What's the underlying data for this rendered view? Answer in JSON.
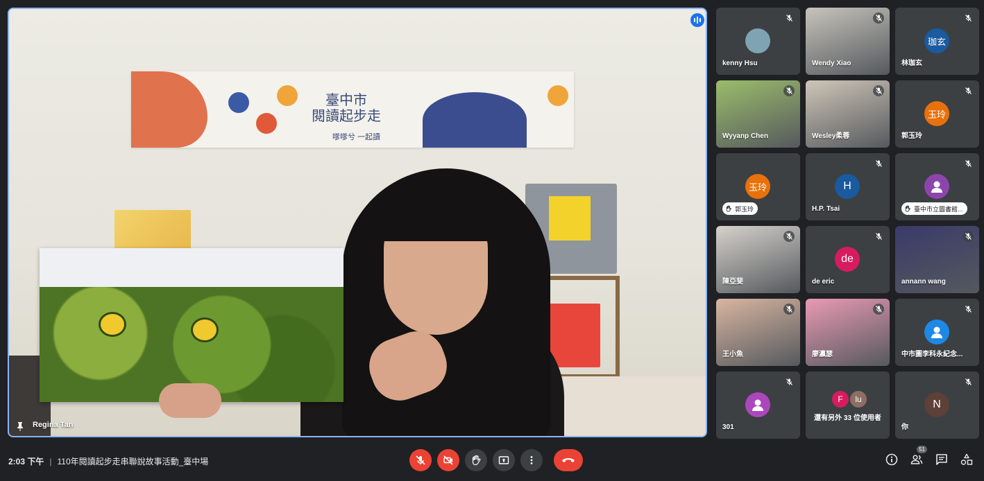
{
  "stage": {
    "speaker_name": "Regina Tan",
    "banner_title_line1": "臺中市",
    "banner_title_line2": "閱讀起步走",
    "banner_sub": "嗲嗲兮 一起讀"
  },
  "participants": [
    {
      "name": "kenny Hsu",
      "type": "photo",
      "color": "#7fa3b3",
      "muted": true
    },
    {
      "name": "Wendy Xiao",
      "type": "video",
      "color": "#c7c4bc",
      "muted": true
    },
    {
      "name": "林珈玄",
      "type": "avatar",
      "initials": "珈玄",
      "color": "#1a5a9e",
      "muted": true
    },
    {
      "name": "Wyyanp Chen",
      "type": "video",
      "color": "#9bbd6b",
      "muted": true
    },
    {
      "name": "Wesley柔蓉",
      "type": "video",
      "color": "#cfc6b8",
      "muted": true
    },
    {
      "name": "郭玉玲",
      "type": "avatar",
      "initials": "玉玲",
      "color": "#e8710a",
      "muted": true
    },
    {
      "name": "郭玉玲",
      "type": "avatar-hand",
      "initials": "玉玲",
      "color": "#e8710a",
      "muted": false
    },
    {
      "name": "H.P. Tsai",
      "type": "avatar",
      "initials": "H",
      "color": "#1a5a9e",
      "muted": true
    },
    {
      "name": "臺中市立圖書館...",
      "type": "avatar-hand",
      "initials": "",
      "color": "#8e44ad",
      "muted": true
    },
    {
      "name": "陳亞斐",
      "type": "video",
      "color": "#d6d2cc",
      "muted": true
    },
    {
      "name": "de eric",
      "type": "avatar",
      "initials": "de",
      "color": "#d81b60",
      "muted": true
    },
    {
      "name": "annann wang",
      "type": "video",
      "color": "#3a3a6a",
      "muted": true
    },
    {
      "name": "王小魚",
      "type": "video",
      "color": "#d9b5a1",
      "muted": true
    },
    {
      "name": "廖瀛瑟",
      "type": "video",
      "color": "#e99ab3",
      "muted": true
    },
    {
      "name": "中市圖李科永紀念...",
      "type": "avatar",
      "initials": "",
      "color": "#1e88e5",
      "muted": true
    },
    {
      "name": "301",
      "type": "avatar",
      "initials": "",
      "color": "#ab47bc",
      "muted": true
    },
    {
      "name": "還有另外 33 位使用者",
      "type": "more",
      "initials": [
        "F",
        "lu"
      ],
      "colors": [
        "#d81b60",
        "#8d6e63"
      ],
      "muted": false
    },
    {
      "name": "你",
      "type": "avatar",
      "initials": "N",
      "color": "#5d4037",
      "muted": true
    }
  ],
  "bottom": {
    "time": "2:03 下午",
    "separator": "|",
    "meeting_title": "110年閱讀起步走串聯說故事活動_臺中場",
    "participant_count": "51"
  }
}
